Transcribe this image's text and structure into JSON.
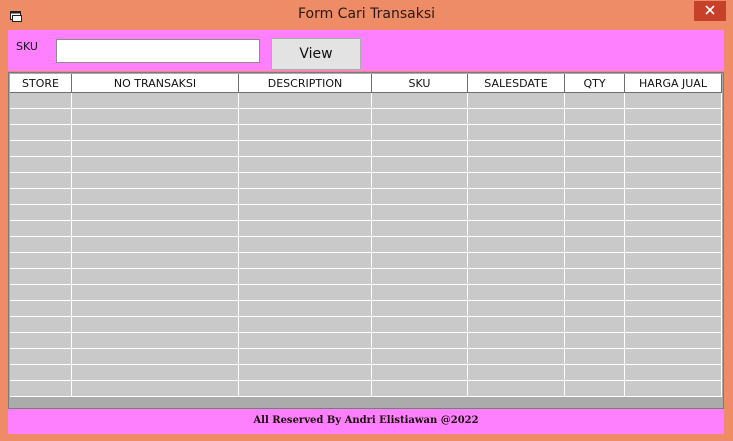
{
  "window": {
    "title": "Form Cari Transaksi",
    "close_icon": "close-icon",
    "app_icon": "window-icon"
  },
  "search": {
    "sku_label": "SKU",
    "sku_value": "",
    "view_label": "View"
  },
  "grid": {
    "columns": [
      "STORE",
      "NO TRANSAKSI",
      "DESCRIPTION",
      "SKU",
      "SALESDATE",
      "QTY",
      "HARGA JUAL"
    ],
    "rows": []
  },
  "footer": {
    "text": "All Reserved By Andri Elistiawan @2022"
  },
  "colors": {
    "frame": "#ed8c66",
    "panel_pink": "#ff80ff",
    "grid_cell": "#c9c9c9",
    "close_button": "#c7402a"
  }
}
